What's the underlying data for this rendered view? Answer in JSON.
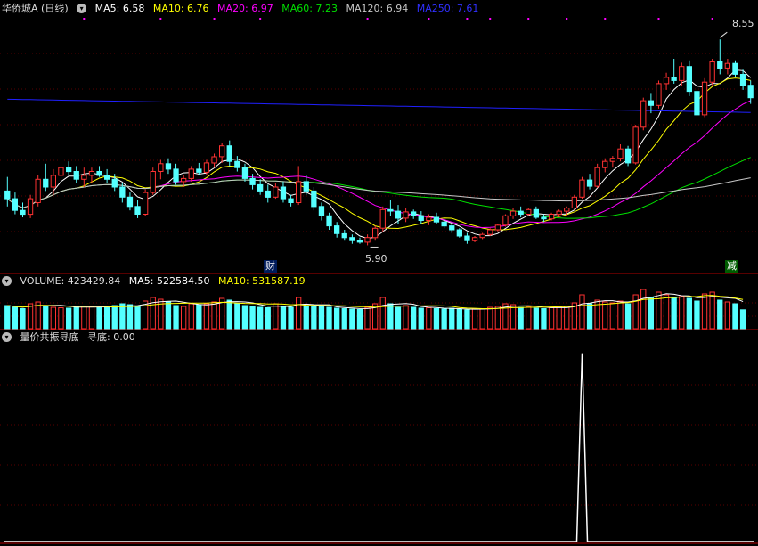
{
  "header": {
    "stock_title": "华侨城A (日线)",
    "ma5_label": "MA5: 6.58",
    "ma10_label": "MA10: 6.76",
    "ma20_label": "MA20: 6.97",
    "ma60_label": "MA60: 7.23",
    "ma120_label": "MA120: 6.94",
    "ma250_label": "MA250: 7.61"
  },
  "volume_header": {
    "title": "VOLUME: 423429.84",
    "ma5_label": "MA5: 522584.50",
    "ma10_label": "MA10: 531587.19"
  },
  "indicator_header": {
    "title": "量价共振寻底",
    "value_label": "寻底: 0.00"
  },
  "markers": {
    "low_label": "5.90",
    "high_label": "8.55",
    "event_1": "财",
    "event_2": "减"
  },
  "colors": {
    "up": "#ff3232",
    "down": "#54ffff",
    "ma5": "#ffffff",
    "ma10": "#ffff00",
    "ma20": "#ff00ff",
    "ma60": "#00e000",
    "ma120": "#c8c8c8",
    "ma250": "#2020ff",
    "panel_border": "#b00000",
    "event_box_1": "#001c5c",
    "event_box_2": "#005c00"
  },
  "chart_data": [
    {
      "type": "candlestick",
      "price_range": [
        5.55,
        8.85
      ],
      "low_marker": 5.9,
      "high_marker": 8.55,
      "ma_last": {
        "ma5": 6.58,
        "ma10": 6.76,
        "ma20": 6.97,
        "ma60": 7.23,
        "ma120": 6.94,
        "ma250": 7.61
      },
      "ohlc": [
        [
          6.6,
          6.78,
          6.4,
          6.5
        ],
        [
          6.5,
          6.58,
          6.3,
          6.35
        ],
        [
          6.35,
          6.45,
          6.26,
          6.3
        ],
        [
          6.3,
          6.55,
          6.25,
          6.5
        ],
        [
          6.45,
          6.8,
          6.4,
          6.75
        ],
        [
          6.75,
          6.95,
          6.6,
          6.65
        ],
        [
          6.65,
          6.88,
          6.55,
          6.8
        ],
        [
          6.8,
          6.95,
          6.72,
          6.9
        ],
        [
          6.9,
          6.98,
          6.8,
          6.85
        ],
        [
          6.85,
          6.92,
          6.7,
          6.75
        ],
        [
          6.75,
          6.9,
          6.65,
          6.8
        ],
        [
          6.8,
          6.9,
          6.7,
          6.85
        ],
        [
          6.85,
          6.92,
          6.78,
          6.8
        ],
        [
          6.8,
          6.88,
          6.7,
          6.75
        ],
        [
          6.75,
          6.82,
          6.6,
          6.65
        ],
        [
          6.65,
          6.7,
          6.45,
          6.52
        ],
        [
          6.52,
          6.58,
          6.35,
          6.4
        ],
        [
          6.4,
          6.48,
          6.25,
          6.3
        ],
        [
          6.3,
          6.62,
          6.28,
          6.58
        ],
        [
          6.58,
          6.9,
          6.55,
          6.85
        ],
        [
          6.85,
          7.0,
          6.75,
          6.95
        ],
        [
          6.95,
          7.02,
          6.82,
          6.88
        ],
        [
          6.88,
          6.95,
          6.68,
          6.72
        ],
        [
          6.72,
          6.8,
          6.65,
          6.76
        ],
        [
          6.76,
          6.92,
          6.72,
          6.88
        ],
        [
          6.88,
          6.96,
          6.8,
          6.84
        ],
        [
          6.84,
          7.0,
          6.8,
          6.96
        ],
        [
          6.96,
          7.08,
          6.9,
          7.04
        ],
        [
          7.04,
          7.22,
          6.96,
          7.18
        ],
        [
          7.18,
          7.25,
          6.92,
          6.98
        ],
        [
          6.98,
          7.05,
          6.85,
          6.9
        ],
        [
          6.9,
          6.95,
          6.72,
          6.76
        ],
        [
          6.76,
          6.82,
          6.62,
          6.68
        ],
        [
          6.68,
          6.75,
          6.55,
          6.6
        ],
        [
          6.6,
          6.68,
          6.45,
          6.52
        ],
        [
          6.52,
          6.7,
          6.5,
          6.65
        ],
        [
          6.65,
          6.72,
          6.45,
          6.5
        ],
        [
          6.5,
          6.55,
          6.4,
          6.45
        ],
        [
          6.45,
          6.92,
          6.42,
          6.72
        ],
        [
          6.72,
          6.8,
          6.55,
          6.6
        ],
        [
          6.6,
          6.65,
          6.35,
          6.4
        ],
        [
          6.4,
          6.45,
          6.22,
          6.28
        ],
        [
          6.28,
          6.32,
          6.1,
          6.15
        ],
        [
          6.15,
          6.2,
          6.0,
          6.05
        ],
        [
          6.05,
          6.1,
          5.96,
          6.0
        ],
        [
          6.0,
          6.04,
          5.92,
          5.96
        ],
        [
          5.96,
          6.0,
          5.92,
          5.94
        ],
        [
          5.94,
          6.04,
          5.9,
          6.0
        ],
        [
          6.0,
          6.15,
          5.96,
          6.12
        ],
        [
          6.12,
          6.4,
          6.08,
          6.36
        ],
        [
          6.36,
          6.48,
          6.28,
          6.34
        ],
        [
          6.34,
          6.42,
          6.18,
          6.25
        ],
        [
          6.25,
          6.38,
          6.2,
          6.33
        ],
        [
          6.33,
          6.36,
          6.24,
          6.28
        ],
        [
          6.28,
          6.34,
          6.18,
          6.22
        ],
        [
          6.22,
          6.3,
          6.16,
          6.26
        ],
        [
          6.26,
          6.32,
          6.18,
          6.2
        ],
        [
          6.2,
          6.24,
          6.12,
          6.15
        ],
        [
          6.15,
          6.18,
          6.06,
          6.1
        ],
        [
          6.1,
          6.12,
          6.0,
          6.02
        ],
        [
          6.02,
          6.06,
          5.92,
          5.96
        ],
        [
          5.96,
          6.02,
          5.94,
          6.0
        ],
        [
          6.0,
          6.06,
          5.98,
          6.04
        ],
        [
          6.04,
          6.12,
          6.02,
          6.1
        ],
        [
          6.1,
          6.18,
          6.08,
          6.16
        ],
        [
          6.16,
          6.3,
          6.14,
          6.28
        ],
        [
          6.28,
          6.38,
          6.24,
          6.34
        ],
        [
          6.34,
          6.4,
          6.26,
          6.3
        ],
        [
          6.3,
          6.38,
          6.28,
          6.36
        ],
        [
          6.36,
          6.4,
          6.24,
          6.26
        ],
        [
          6.26,
          6.3,
          6.2,
          6.24
        ],
        [
          6.24,
          6.32,
          6.22,
          6.3
        ],
        [
          6.3,
          6.36,
          6.26,
          6.34
        ],
        [
          6.34,
          6.4,
          6.28,
          6.38
        ],
        [
          6.38,
          6.55,
          6.36,
          6.52
        ],
        [
          6.52,
          6.78,
          6.5,
          6.74
        ],
        [
          6.74,
          6.82,
          6.62,
          6.66
        ],
        [
          6.66,
          6.95,
          6.64,
          6.9
        ],
        [
          6.9,
          7.02,
          6.84,
          6.98
        ],
        [
          6.98,
          7.05,
          6.9,
          7.02
        ],
        [
          7.02,
          7.2,
          6.98,
          7.14
        ],
        [
          7.14,
          7.18,
          6.92,
          6.96
        ],
        [
          6.96,
          7.45,
          6.94,
          7.42
        ],
        [
          7.42,
          7.8,
          7.38,
          7.76
        ],
        [
          7.76,
          7.86,
          7.6,
          7.7
        ],
        [
          7.7,
          8.02,
          7.66,
          7.98
        ],
        [
          7.98,
          8.12,
          7.9,
          8.06
        ],
        [
          8.06,
          8.3,
          7.98,
          8.02
        ],
        [
          8.02,
          8.25,
          7.95,
          8.2
        ],
        [
          8.2,
          8.28,
          7.82,
          7.88
        ],
        [
          7.88,
          7.92,
          7.5,
          7.58
        ],
        [
          7.58,
          8.05,
          7.55,
          8.0
        ],
        [
          8.0,
          8.3,
          7.96,
          8.26
        ],
        [
          8.26,
          8.55,
          8.1,
          8.18
        ],
        [
          8.18,
          8.3,
          8.1,
          8.24
        ],
        [
          8.24,
          8.28,
          8.06,
          8.1
        ],
        [
          8.1,
          8.16,
          7.9,
          7.96
        ],
        [
          7.96,
          8.02,
          7.72,
          7.8
        ]
      ],
      "volume": {
        "last": 423429.84,
        "ma5": 522584.5,
        "ma10": 531587.19,
        "max": 900000,
        "values": [
          520000,
          480000,
          450000,
          560000,
          600000,
          520000,
          480000,
          470000,
          460000,
          500000,
          510000,
          490000,
          480000,
          470000,
          520000,
          560000,
          540000,
          500000,
          620000,
          700000,
          660000,
          600000,
          520000,
          500000,
          560000,
          540000,
          560000,
          600000,
          680000,
          640000,
          560000,
          520000,
          500000,
          480000,
          470000,
          560000,
          500000,
          480000,
          700000,
          520000,
          500000,
          490000,
          480000,
          460000,
          450000,
          440000,
          430000,
          480000,
          560000,
          700000,
          560000,
          480000,
          520000,
          480000,
          460000,
          470000,
          450000,
          440000,
          460000,
          430000,
          420000,
          440000,
          450000,
          480000,
          500000,
          560000,
          540000,
          480000,
          500000,
          460000,
          450000,
          470000,
          480000,
          500000,
          580000,
          760000,
          560000,
          640000,
          600000,
          580000,
          620000,
          560000,
          760000,
          880000,
          700000,
          820000,
          760000,
          700000,
          720000,
          680000,
          620000,
          780000,
          820000,
          640000,
          600000,
          560000,
          423429.84
        ]
      }
    },
    {
      "type": "line",
      "title": "量价共振寻底",
      "series": [
        {
          "name": "寻底",
          "last": 0.0,
          "spike_index": 75,
          "spike_value": 1.0
        }
      ],
      "ylim": [
        0,
        1.05
      ]
    }
  ]
}
